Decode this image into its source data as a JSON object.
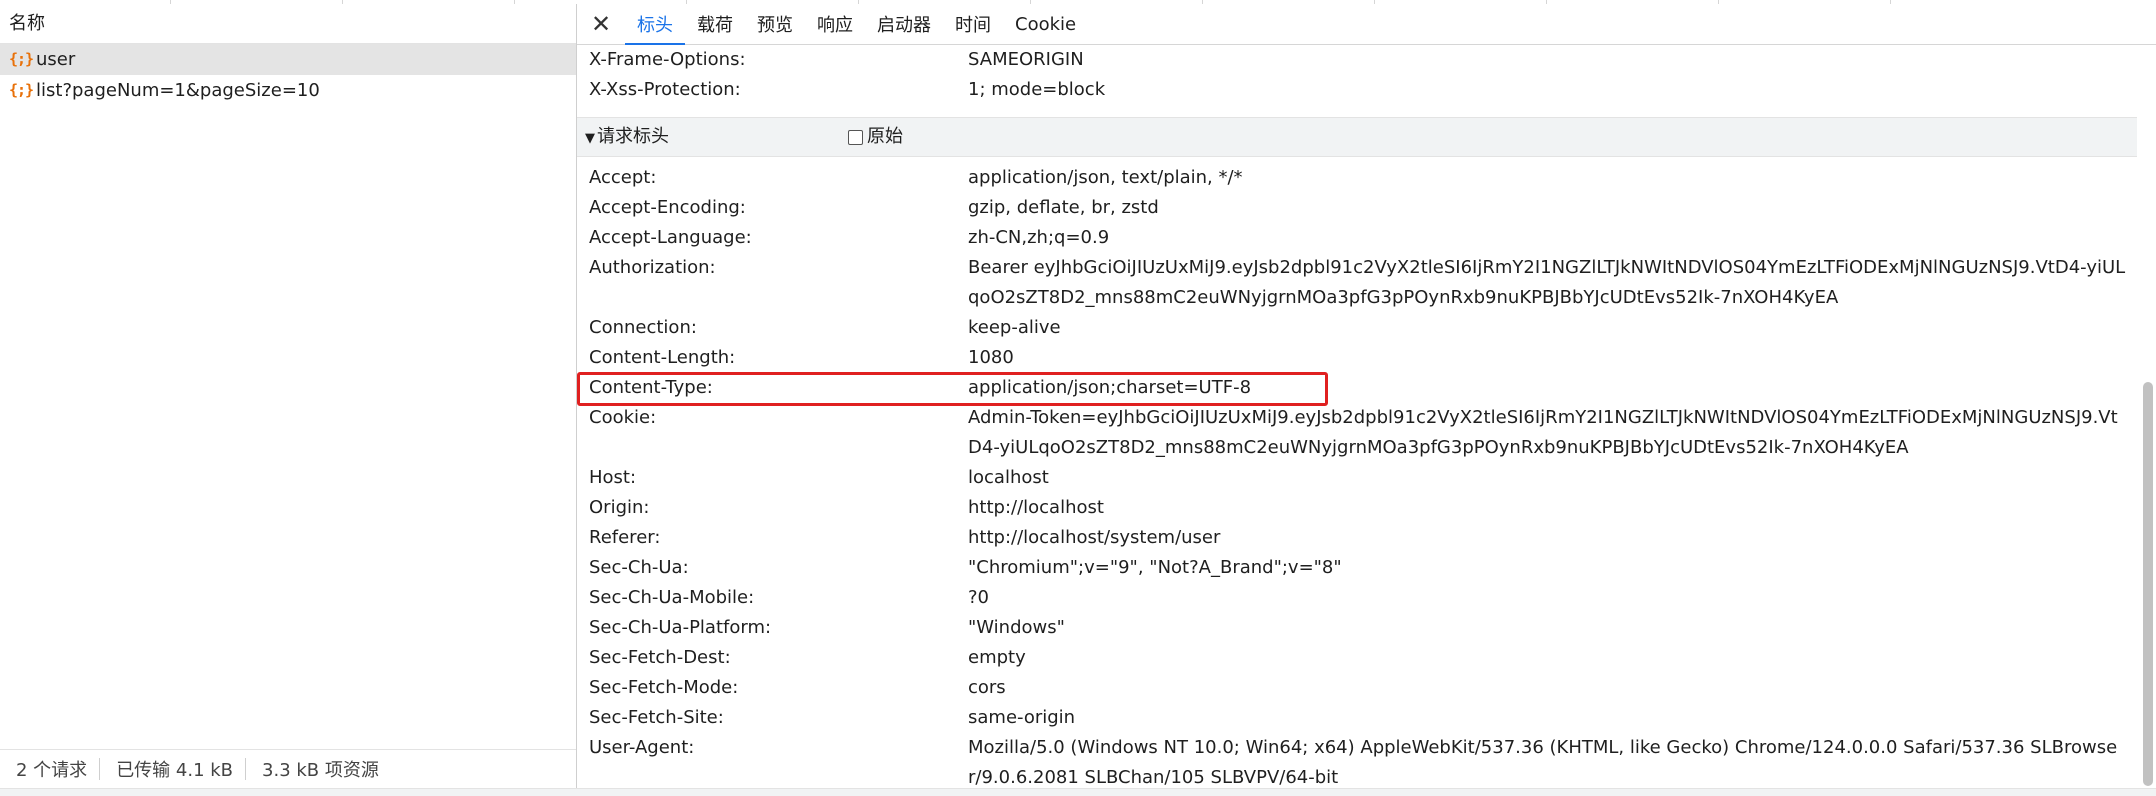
{
  "left": {
    "header": "名称",
    "requests": [
      {
        "icon": "{;}",
        "label": "user",
        "selected": true
      },
      {
        "icon": "{;}",
        "label": "list?pageNum=1&pageSize=10",
        "selected": false
      }
    ],
    "footer": {
      "requests": "2 个请求",
      "transferred": "已传输 4.1 kB",
      "resources": "3.3 kB 项资源"
    }
  },
  "tabs": {
    "close": "✕",
    "items": [
      "标头",
      "载荷",
      "预览",
      "响应",
      "启动器",
      "时间",
      "Cookie"
    ],
    "active": "标头"
  },
  "response_tail": [
    {
      "name": "X-Frame-Options:",
      "value": "SAMEORIGIN"
    },
    {
      "name": "X-Xss-Protection:",
      "value": "1; mode=block"
    }
  ],
  "request_section": {
    "title": "请求标头",
    "toggle": "▼",
    "raw_label": "原始"
  },
  "request_headers": [
    {
      "name": "Accept:",
      "value": "application/json, text/plain, */*"
    },
    {
      "name": "Accept-Encoding:",
      "value": "gzip, deflate, br, zstd"
    },
    {
      "name": "Accept-Language:",
      "value": "zh-CN,zh;q=0.9"
    },
    {
      "name": "Authorization:",
      "value": "Bearer eyJhbGciOiJIUzUxMiJ9.eyJsb2dpbl91c2VyX2tleSI6IjRmY2I1NGZlLTJkNWItNDVlOS04YmEzLTFiODExMjNlNGUzNSJ9.VtD4-yiULqoO2sZT8D2_mns88mC2euWNyjgrnMOa3pfG3pPOynRxb9nuKPBJBbYJcUDtEvs52Ik-7nXOH4KyEA"
    },
    {
      "name": "Connection:",
      "value": "keep-alive"
    },
    {
      "name": "Content-Length:",
      "value": "1080"
    },
    {
      "name": "Content-Type:",
      "value": "application/json;charset=UTF-8"
    },
    {
      "name": "Cookie:",
      "value": "Admin-Token=eyJhbGciOiJIUzUxMiJ9.eyJsb2dpbl91c2VyX2tleSI6IjRmY2I1NGZlLTJkNWItNDVlOS04YmEzLTFiODExMjNlNGUzNSJ9.VtD4-yiULqoO2sZT8D2_mns88mC2euWNyjgrnMOa3pfG3pPOynRxb9nuKPBJBbYJcUDtEvs52Ik-7nXOH4KyEA"
    },
    {
      "name": "Host:",
      "value": "localhost"
    },
    {
      "name": "Origin:",
      "value": "http://localhost"
    },
    {
      "name": "Referer:",
      "value": "http://localhost/system/user"
    },
    {
      "name": "Sec-Ch-Ua:",
      "value": "\"Chromium\";v=\"9\", \"Not?A_Brand\";v=\"8\""
    },
    {
      "name": "Sec-Ch-Ua-Mobile:",
      "value": "?0"
    },
    {
      "name": "Sec-Ch-Ua-Platform:",
      "value": "\"Windows\""
    },
    {
      "name": "Sec-Fetch-Dest:",
      "value": "empty"
    },
    {
      "name": "Sec-Fetch-Mode:",
      "value": "cors"
    },
    {
      "name": "Sec-Fetch-Site:",
      "value": "same-origin"
    },
    {
      "name": "User-Agent:",
      "value": "Mozilla/5.0 (Windows NT 10.0; Win64; x64) AppleWebKit/537.36 (KHTML, like Gecko) Chrome/124.0.0.0 Safari/537.36 SLBrowser/9.0.6.2081 SLBChan/105 SLBVPV/64-bit"
    }
  ],
  "colors": {
    "accent": "#1a73e8",
    "highlight": "#e02020",
    "json_icon": "#e8710a",
    "selected_row": "#e4e4e4"
  }
}
